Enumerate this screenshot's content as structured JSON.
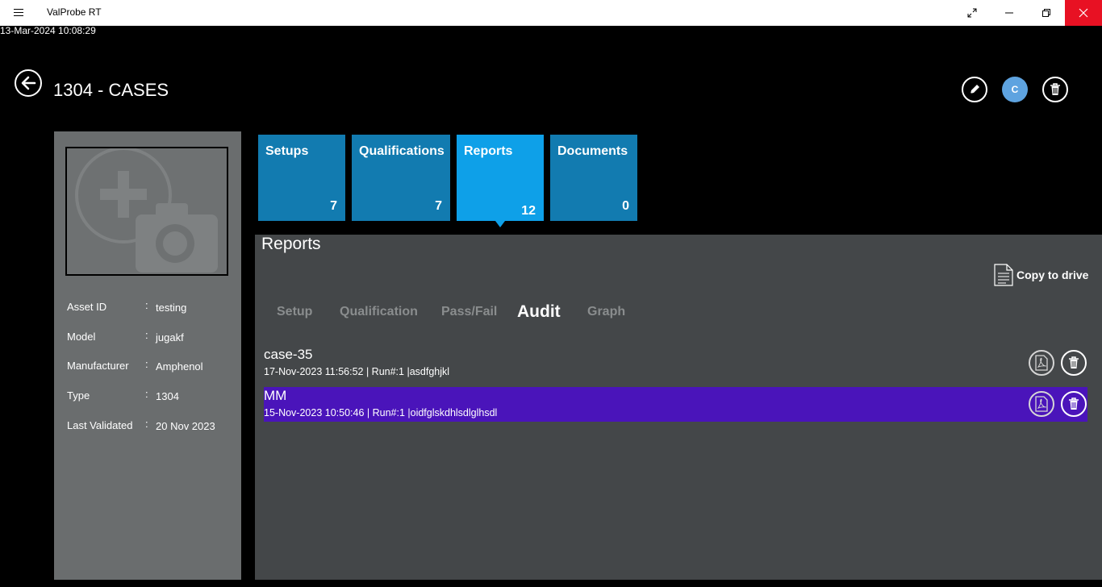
{
  "window": {
    "title": "ValProbe RT"
  },
  "datetime": "13-Mar-2024 10:08:29",
  "header": {
    "title": "1304 - CASES",
    "user_initial": "C"
  },
  "asset": {
    "fields": [
      {
        "label": "Asset ID",
        "colon": ":",
        "value": "testing"
      },
      {
        "label": "Model",
        "colon": ":",
        "value": "jugakf"
      },
      {
        "label": "Manufacturer",
        "colon": ":",
        "value": "Amphenol"
      },
      {
        "label": "Type",
        "colon": ":",
        "value": "1304"
      },
      {
        "label": "Last Validated",
        "colon": ":",
        "value": "20 Nov 2023"
      }
    ]
  },
  "tiles": [
    {
      "label": "Setups",
      "count": "7"
    },
    {
      "label": "Qualifications",
      "count": "7"
    },
    {
      "label": "Reports",
      "count": "12",
      "active": true
    },
    {
      "label": "Documents",
      "count": "0"
    }
  ],
  "reports": {
    "title": "Reports",
    "copy_label": "Copy to drive",
    "subtabs": [
      "Setup",
      "Qualification",
      "Pass/Fail",
      "Audit",
      "Graph"
    ],
    "active_subtab": "Audit",
    "items": [
      {
        "name": "case-35",
        "meta": "17-Nov-2023 11:56:52 | Run#:1 |asdfghjkl",
        "selected": false
      },
      {
        "name": "MM",
        "meta": "15-Nov-2023 10:50:46 | Run#:1 |oidfglskdhlsdlglhsdl",
        "selected": true
      }
    ]
  },
  "colors": {
    "tile": "#127bb0",
    "tile_active": "#0ea0e8",
    "selected_row": "#4a14ba",
    "close": "#e81123",
    "avatar": "#5ea3e0"
  }
}
